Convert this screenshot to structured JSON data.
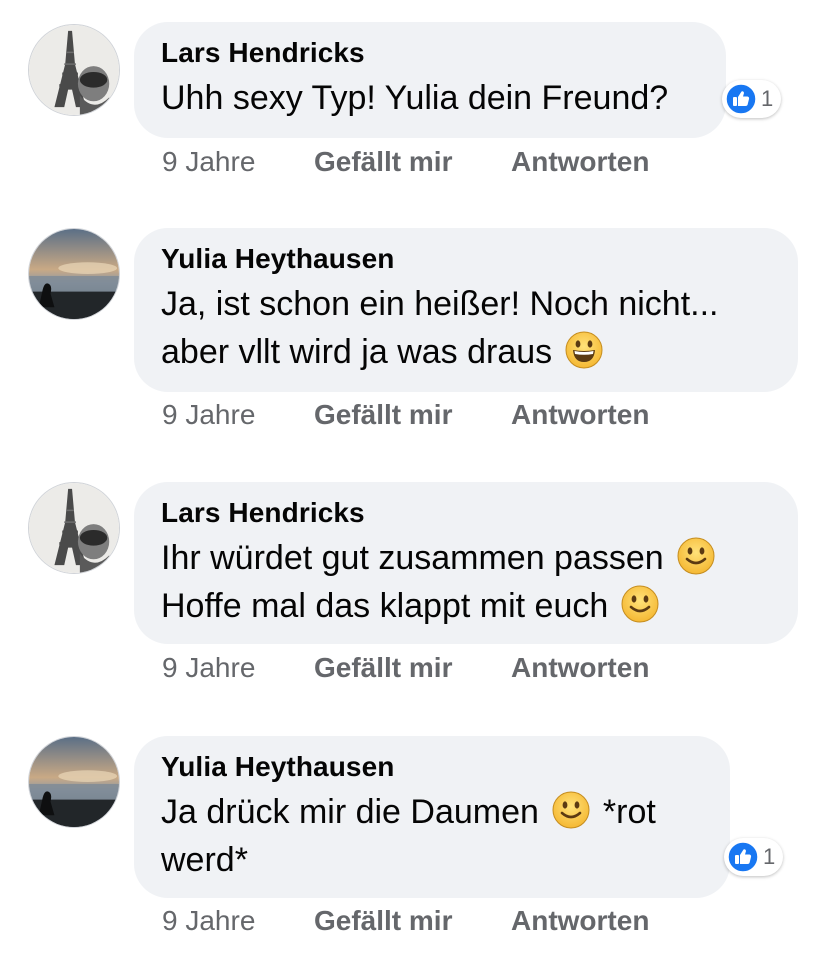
{
  "colors": {
    "bubble": "#f0f2f5",
    "meta": "#65676b",
    "like_blue": "#1877f2"
  },
  "comments": [
    {
      "author": "Lars Hendricks",
      "avatar": "eiffel-tower-avatar",
      "lines": [
        "Uhh sexy Typ! Yulia dein Freund?"
      ],
      "time": "9 Jahre",
      "like_label": "Gefällt mir",
      "reply_label": "Antworten",
      "reactions": {
        "icon": "like-icon",
        "count": "1"
      }
    },
    {
      "author": "Yulia Heythausen",
      "avatar": "sunset-beach-avatar",
      "lines": [
        "Ja, ist schon ein heißer! Noch nicht...",
        "aber vllt wird ja was draus"
      ],
      "emoji": [
        "grinning-face-emoji"
      ],
      "time": "9 Jahre",
      "like_label": "Gefällt mir",
      "reply_label": "Antworten"
    },
    {
      "author": "Lars Hendricks",
      "avatar": "eiffel-tower-avatar",
      "lines": [
        "Ihr würdet gut zusammen passen",
        "Hoffe mal das klappt mit euch"
      ],
      "emoji": [
        "slightly-smiling-face-emoji",
        "slightly-smiling-face-emoji"
      ],
      "time": "9 Jahre",
      "like_label": "Gefällt mir",
      "reply_label": "Antworten"
    },
    {
      "author": "Yulia Heythausen",
      "avatar": "sunset-beach-avatar",
      "lines": [
        "Ja drück mir die Daumen",
        "*rot",
        "werd*"
      ],
      "emoji": [
        "slightly-smiling-face-emoji"
      ],
      "time": "9 Jahre",
      "like_label": "Gefällt mir",
      "reply_label": "Antworten",
      "reactions": {
        "icon": "like-icon",
        "count": "1"
      }
    }
  ]
}
